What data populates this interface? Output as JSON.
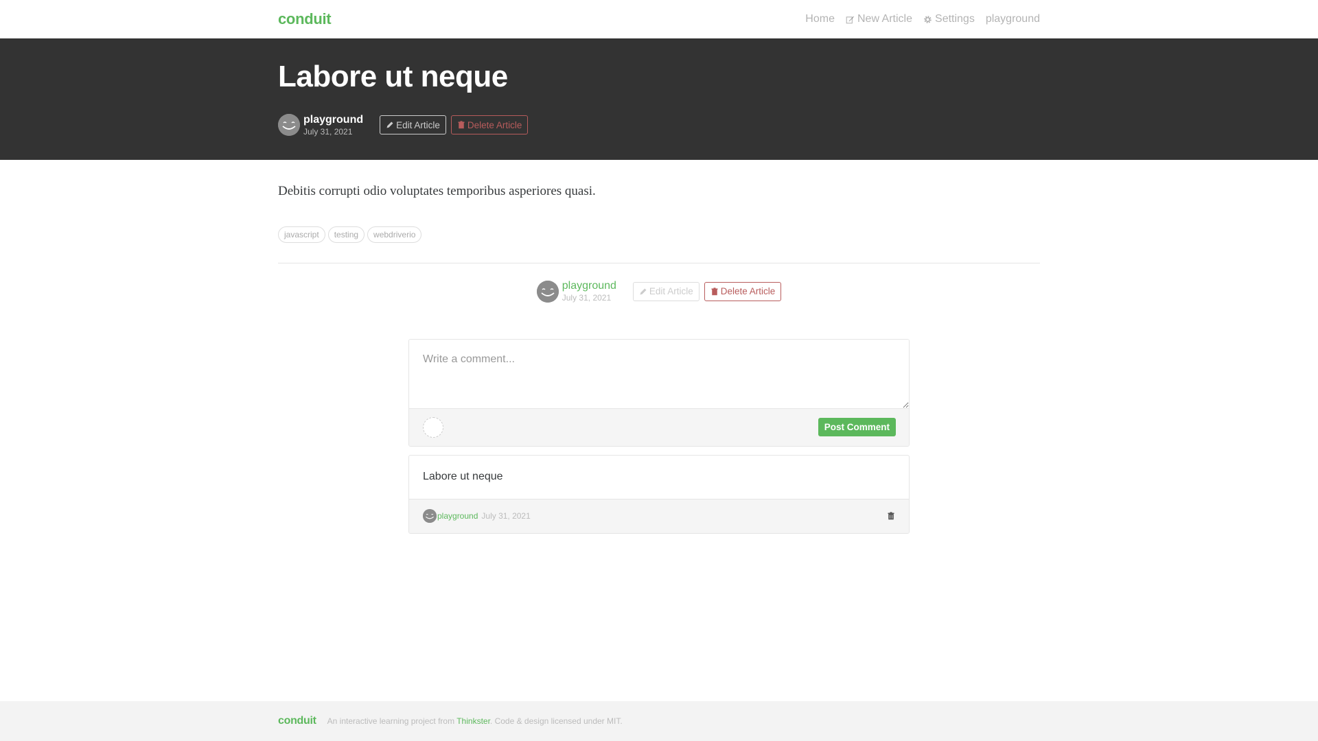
{
  "navbar": {
    "brand": "conduit",
    "links": {
      "home": "Home",
      "new_article": "New Article",
      "settings": "Settings",
      "profile": "playground"
    }
  },
  "article": {
    "title": "Labore ut neque",
    "author": "playground",
    "date": "July 31, 2021",
    "body": "Debitis corrupti odio voluptates temporibus asperiores quasi.",
    "tags": [
      "javascript",
      "testing",
      "webdriverio"
    ],
    "edit_label": "Edit Article",
    "delete_label": "Delete Article"
  },
  "comment_form": {
    "placeholder": "Write a comment...",
    "submit_label": "Post Comment"
  },
  "comments": [
    {
      "text": "Labore ut neque",
      "author": "playground",
      "date": "July 31, 2021"
    }
  ],
  "footer": {
    "brand": "conduit",
    "text_before": "An interactive learning project from",
    "link": "Thinkster",
    "text_after": ". Code & design licensed under MIT."
  },
  "colors": {
    "accent": "#5cb85c",
    "danger": "#b85c5c",
    "banner": "#333333"
  }
}
